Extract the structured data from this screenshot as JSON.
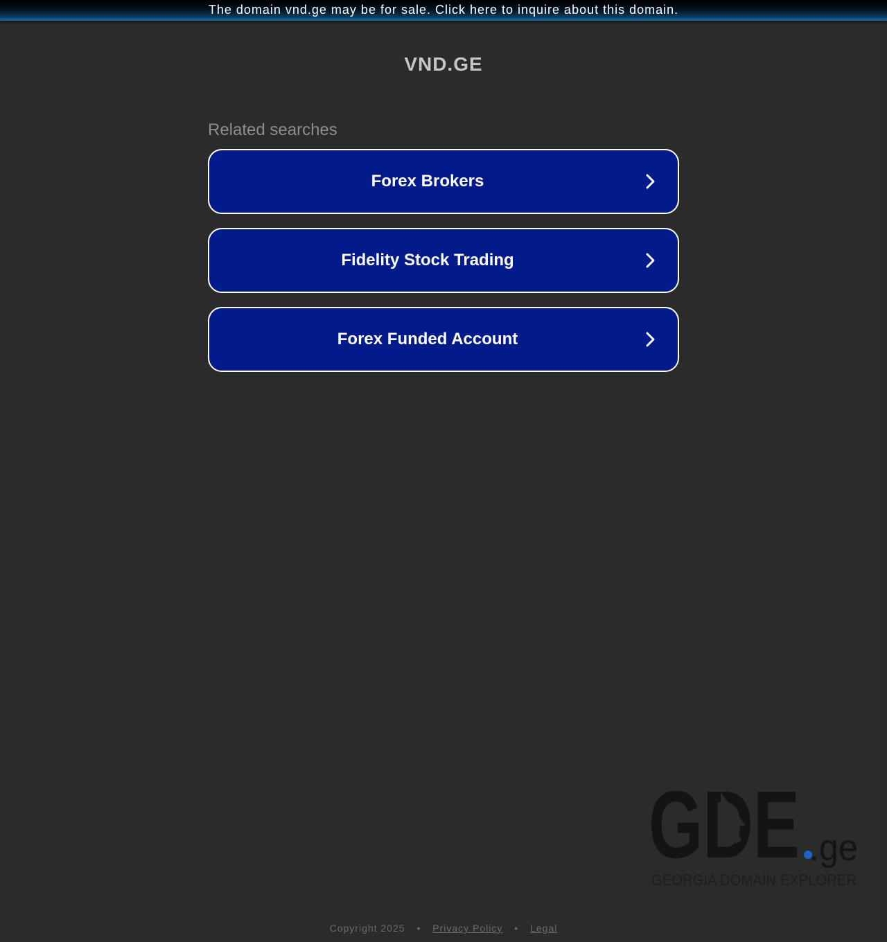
{
  "banner": {
    "text": "The domain vnd.ge may be for sale. Click here to inquire about this domain."
  },
  "site": {
    "title": "VND.GE"
  },
  "related": {
    "heading": "Related searches",
    "items": [
      {
        "label": "Forex Brokers",
        "icon": "chevron-right-icon"
      },
      {
        "label": "Fidelity Stock Trading",
        "icon": "chevron-right-icon"
      },
      {
        "label": "Forex Funded Account",
        "icon": "chevron-right-icon"
      }
    ]
  },
  "logo": {
    "wordmark": "GDE",
    "suffix": ".ge",
    "tagline": "GEORGIA DOMAIN EXPLORER",
    "icon": "cursor-arrow-icon"
  },
  "footer": {
    "copyright": "Copyright 2025",
    "separator": "•",
    "privacy": "Privacy Policy",
    "legal": "Legal"
  },
  "colors": {
    "background": "#2b2b2b",
    "button_fill": "#021a8a",
    "button_border": "#ffffff",
    "logo_dot": "#1d63c9"
  }
}
